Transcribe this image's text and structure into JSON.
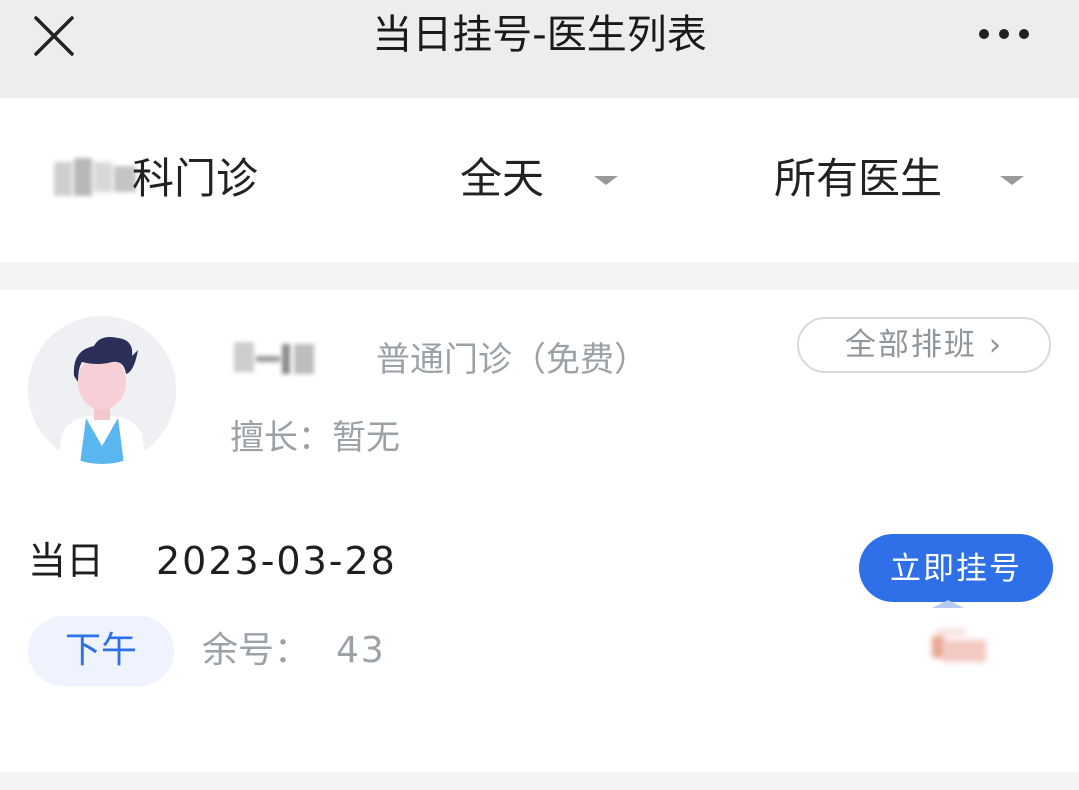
{
  "header": {
    "title": "当日挂号-医生列表",
    "close_icon": "close-icon",
    "more_icon": "more-horizontal-icon"
  },
  "filters": {
    "department_visible": "科门诊",
    "time": "全天",
    "doctor": "所有医生",
    "caret_icon": "caret-down-icon"
  },
  "doctor": {
    "avatar_icon": "doctor-avatar-icon",
    "clinic_type": "普通门诊（免费）",
    "specialty_label": "擅长：",
    "specialty_value": "暂无",
    "schedule_button": "全部排班",
    "schedule_chevron": "›"
  },
  "slot": {
    "day_label": "当日",
    "date": "2023-03-28",
    "period": "下午",
    "remaining_label": "余号：",
    "remaining_count": "43",
    "register_button": "立即挂号"
  },
  "colors": {
    "accent": "#2f6fe8",
    "header_bg": "#ededed",
    "muted_text": "#9aa2a8",
    "divider": "#f3f4f6"
  }
}
